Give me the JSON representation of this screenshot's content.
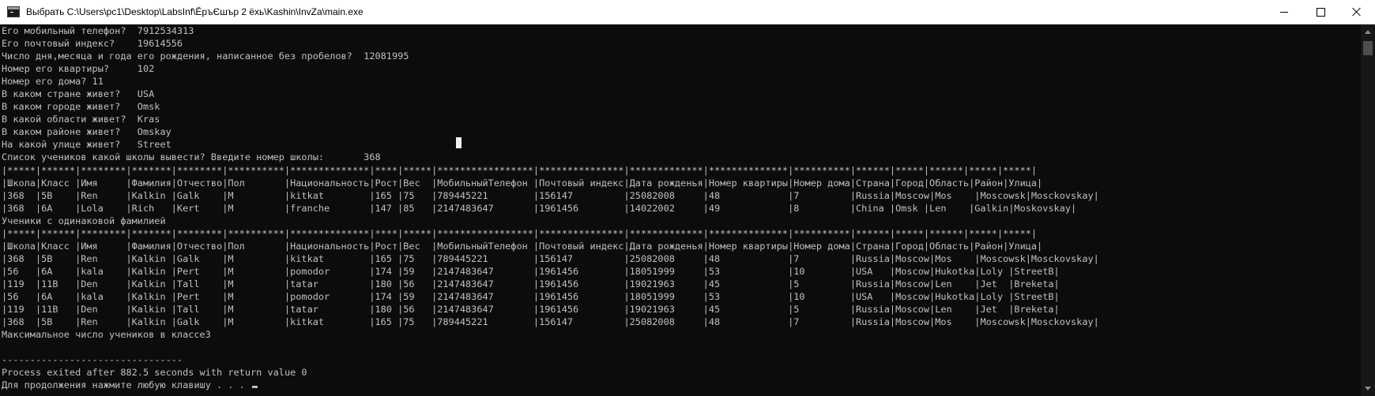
{
  "window": {
    "title": "Выбрать C:\\Users\\pc1\\Desktop\\LabsInf\\ЁръЄшър 2 ёхь\\Kashin\\InvZa\\main.exe",
    "minimize_icon": "minimize-icon",
    "maximize_icon": "maximize-icon",
    "close_icon": "close-icon"
  },
  "console": {
    "lines": [
      "Его мобильный телефон?  7912534313",
      "Его почтовый индекс?    19614556",
      "Число дня,месяца и года его рождения, написанное без пробелов?  12081995",
      "Номер его квартиры?     102",
      "Номер его дома? 11",
      "В каком стране живет?   USA",
      "В каком городе живет?   Omsk",
      "В какой области живет?  Kras",
      "В каком районе живет?   Omskay",
      "На какой улице живет?   Street",
      "Список учеников какой школы вывести? Введите номер школы:       368",
      "|*****|******|********|*******|********|**********|**************|****|*****|*****************|***************|*************|**************|**********|******|*****|******|*****|*****|",
      "|Школа|Класс |Имя     |Фамилия|Отчество|Пол       |Национальность|Рост|Вес  |МобильныйТелефон |Почтовый индекс|Дата рожденья|Номер квартиры|Номер дома|Страна|Город|Область|Район|Улица|",
      "|368  |5B    |Ren     |Kalkin |Galk    |M         |kitkat        |165 |75   |789445221        |156147         |25082008     |48            |7         |Russia|Moscow|Mos    |Moscowsk|Mosckovskay|",
      "|368  |6A    |Lola    |Rich   |Kert    |M         |franche       |147 |85   |2147483647       |1961456        |14022002     |49            |8         |China |Omsk |Len    |Galkin|Moskovskay|",
      "Ученики с одинаковой фамилией",
      "|*****|******|********|*******|********|**********|**************|****|*****|*****************|***************|*************|**************|**********|******|*****|******|*****|*****|",
      "|Школа|Класс |Имя     |Фамилия|Отчество|Пол       |Национальность|Рост|Вес  |МобильныйТелефон |Почтовый индекс|Дата рожденья|Номер квартиры|Номер дома|Страна|Город|Область|Район|Улица|",
      "|368  |5B    |Ren     |Kalkin |Galk    |M         |kitkat        |165 |75   |789445221        |156147         |25082008     |48            |7         |Russia|Moscow|Mos    |Moscowsk|Mosckovskay|",
      "|56   |6A    |kala    |Kalkin |Pert    |M         |pomodor       |174 |59   |2147483647       |1961456        |18051999     |53            |10        |USA   |Moscow|Hukotka|Loly |StreetB|",
      "|119  |11B   |Den     |Kalkin |Tall    |M         |tatar         |180 |56   |2147483647       |1961456        |19021963     |45            |5         |Russia|Moscow|Len    |Jet  |Breketa|",
      "|56   |6A    |kala    |Kalkin |Pert    |M         |pomodor       |174 |59   |2147483647       |1961456        |18051999     |53            |10        |USA   |Moscow|Hukotka|Loly |StreetB|",
      "|119  |11B   |Den     |Kalkin |Tall    |M         |tatar         |180 |56   |2147483647       |1961456        |19021963     |45            |5         |Russia|Moscow|Len    |Jet  |Breketa|",
      "|368  |5B    |Ren     |Kalkin |Galk    |M         |kitkat        |165 |75   |789445221        |156147         |25082008     |48            |7         |Russia|Moscow|Mos    |Moscowsk|Mosckovskay|",
      "Максимальное число учеников в классе3",
      "",
      "--------------------------------",
      "Process exited after 882.5 seconds with return value 0"
    ],
    "prompt": "Для продолжения нажмите любую клавишу . . . "
  }
}
